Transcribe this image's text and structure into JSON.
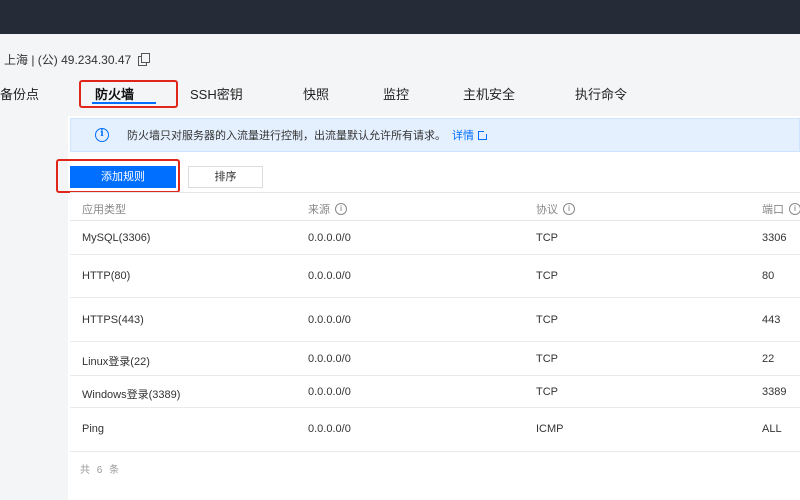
{
  "header": {
    "location": "上海 | (公) 49.234.30.47"
  },
  "tabs": [
    {
      "label": "备份点"
    },
    {
      "label": "防火墙"
    },
    {
      "label": "SSH密钥"
    },
    {
      "label": "快照"
    },
    {
      "label": "监控"
    },
    {
      "label": "主机安全"
    },
    {
      "label": "执行命令"
    }
  ],
  "notice": {
    "text": "防火墙只对服务器的入流量进行控制，出流量默认允许所有请求。",
    "link": "详情"
  },
  "toolbar": {
    "add_rule_label": "添加规则",
    "sort_label": "排序"
  },
  "table": {
    "columns": [
      "应用类型",
      "来源",
      "协议",
      "端口"
    ],
    "rows": [
      {
        "app": "MySQL(3306)",
        "source": "0.0.0.0/0",
        "protocol": "TCP",
        "port": "3306"
      },
      {
        "app": "HTTP(80)",
        "source": "0.0.0.0/0",
        "protocol": "TCP",
        "port": "80"
      },
      {
        "app": "HTTPS(443)",
        "source": "0.0.0.0/0",
        "protocol": "TCP",
        "port": "443"
      },
      {
        "app": "Linux登录(22)",
        "source": "0.0.0.0/0",
        "protocol": "TCP",
        "port": "22"
      },
      {
        "app": "Windows登录(3389)",
        "source": "0.0.0.0/0",
        "protocol": "TCP",
        "port": "3389"
      },
      {
        "app": "Ping",
        "source": "0.0.0.0/0",
        "protocol": "ICMP",
        "port": "ALL"
      }
    ],
    "total": "共 6 条"
  },
  "colors": {
    "topbar": "#262b38",
    "accent": "#006eff",
    "highlight": "#e0251b"
  }
}
